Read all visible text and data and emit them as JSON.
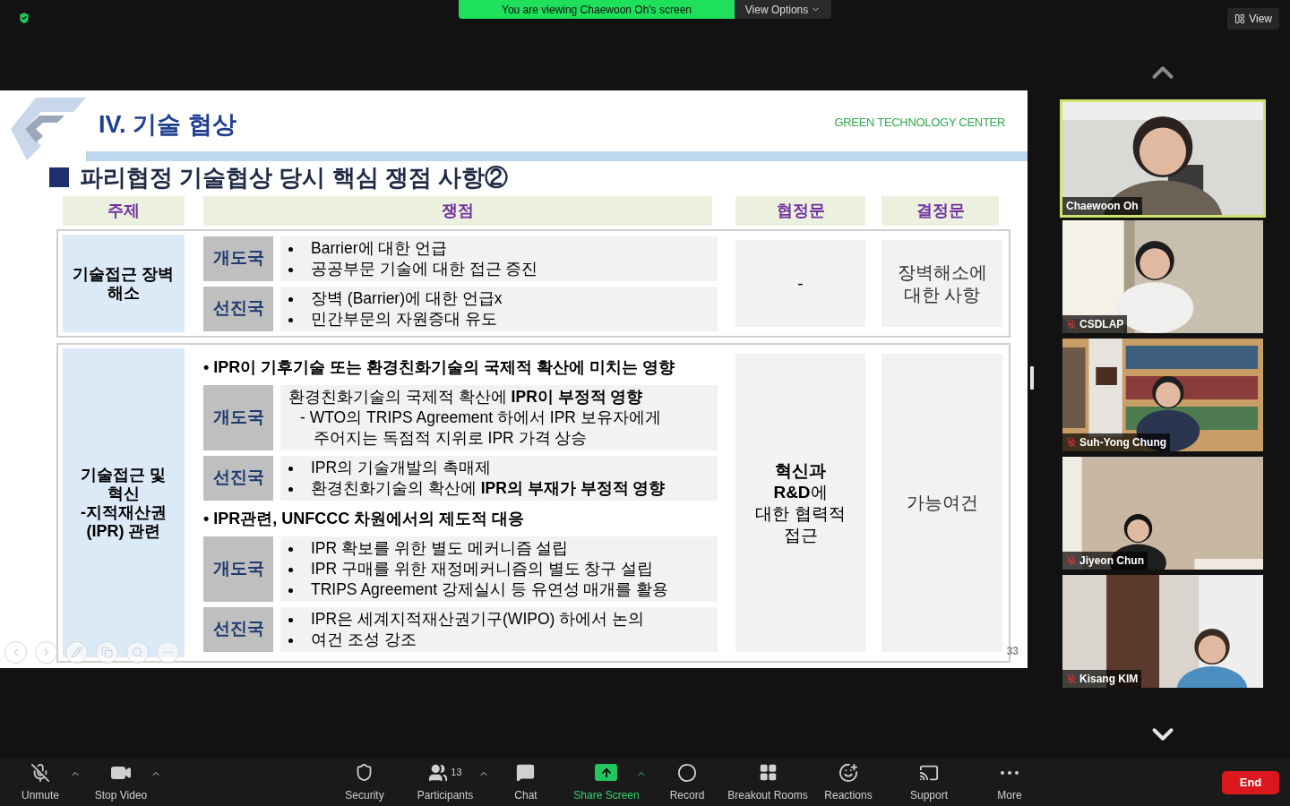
{
  "top_bar": {
    "banner": "You are viewing Chaewoon Oh's screen",
    "view_options": "View Options",
    "view_button": "View"
  },
  "slide": {
    "title": "IV. 기술 협상",
    "logo_text": "GREEN TECHNOLOGY CENTER",
    "heading": "파리협정 기술협상 당시 핵심 쟁점 사항②",
    "columns": [
      "주제",
      "쟁점",
      "협정문",
      "결정문"
    ],
    "sections": [
      {
        "topic": "기술접근 장벽\n해소",
        "groups": [
          {
            "rows": [
              {
                "label": "개도국",
                "kind": "bullets",
                "items": [
                  "Barrier에 대한 언급",
                  "공공부문 기술에 대한 접근 증진"
                ]
              },
              {
                "label": "선진국",
                "kind": "bullets",
                "items": [
                  "장벽 (Barrier)에 대한 언급x",
                  "민간부문의 자원증대 유도"
                ]
              }
            ]
          }
        ],
        "agreement": "-",
        "decision": "장벽해소에\n대한 사항"
      },
      {
        "topic": "기술접근 및\n혁신\n-지적재산권\n(IPR) 관련",
        "groups": [
          {
            "heading": "• IPR이 기후기술 또는 환경친화기술의 국제적 확산에 미치는 영향",
            "rows": [
              {
                "label": "개도국",
                "kind": "lead",
                "lead": "환경친화기술의 국제적 확산에 **IPR이 부정적 영향**",
                "sub": "- WTO의 TRIPS Agreement 하에서 IPR 보유자에게\n주어지는 독점적 지위로 IPR 가격 상승"
              },
              {
                "label": "선진국",
                "kind": "bullets",
                "items": [
                  "IPR의 기술개발의 촉매제",
                  "환경친화기술의 확산에 **IPR의 부재가 부정적 영향**"
                ]
              }
            ]
          },
          {
            "heading": "• IPR관련, UNFCCC 차원에서의 제도적 대응",
            "rows": [
              {
                "label": "개도국",
                "kind": "bullets",
                "items": [
                  "IPR 확보를 위한 별도 메커니즘 설립",
                  "IPR 구매를 위한 재정메커니즘의 별도 창구 설립",
                  "TRIPS Agreement 강제실시 등 유연성 매개를 활용"
                ]
              },
              {
                "label": "선진국",
                "kind": "bullets",
                "items": [
                  "IPR은 세계지적재산권기구(WIPO) 하에서 논의",
                  "여건 조성 강조"
                ]
              }
            ]
          }
        ],
        "agreement": "**혁신과**\n**R&D**에\n대한 협력적\n접근",
        "decision": "가능여건"
      }
    ],
    "page_number": "33"
  },
  "participants": [
    {
      "name": "Chaewoon Oh",
      "muted": false,
      "speaking": true
    },
    {
      "name": "CSDLAP",
      "muted": true,
      "speaking": false
    },
    {
      "name": "Suh-Yong Chung",
      "muted": true,
      "speaking": false
    },
    {
      "name": "Jiyeon Chun",
      "muted": true,
      "speaking": false
    },
    {
      "name": "Kisang KIM",
      "muted": true,
      "speaking": false
    }
  ],
  "toolbar": {
    "left": [
      {
        "kind": "mic-muted",
        "label": "Unmute"
      },
      {
        "kind": "video",
        "label": "Stop Video"
      }
    ],
    "center": [
      {
        "kind": "security",
        "label": "Security"
      },
      {
        "kind": "participants",
        "label": "Participants",
        "count": "13"
      },
      {
        "kind": "chat",
        "label": "Chat"
      },
      {
        "kind": "share",
        "label": "Share Screen"
      },
      {
        "kind": "record",
        "label": "Record"
      },
      {
        "kind": "breakout",
        "label": "Breakout Rooms"
      },
      {
        "kind": "reactions",
        "label": "Reactions"
      },
      {
        "kind": "support",
        "label": "Support"
      },
      {
        "kind": "more",
        "label": "More"
      }
    ],
    "end": "End"
  }
}
